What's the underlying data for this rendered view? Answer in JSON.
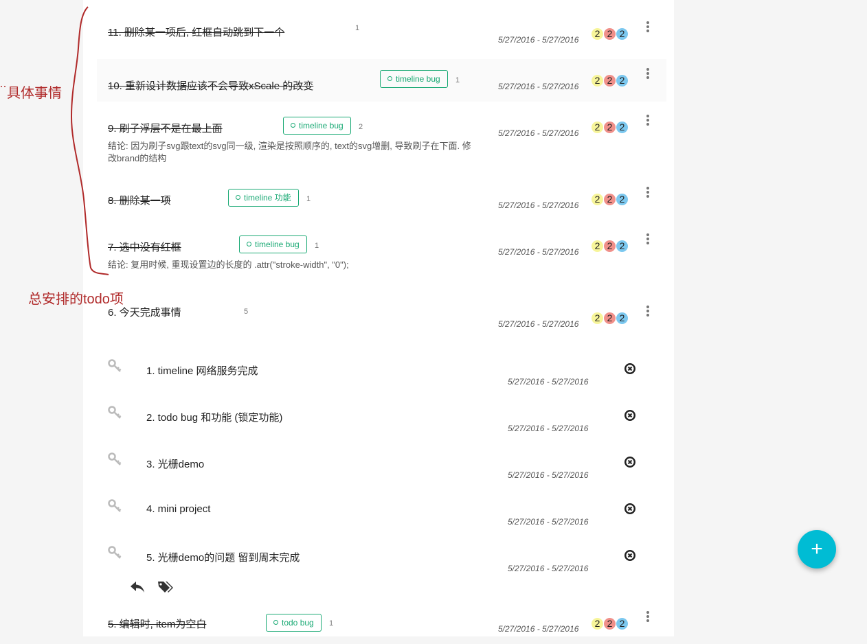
{
  "annotations": {
    "specific": "具体事情",
    "overall": "总安排的todo项"
  },
  "items": [
    {
      "title": "11. 删除某一项后, 红框自动跳到下一个",
      "tag": "",
      "count": "1",
      "date": "5/27/2016 - 5/27/2016",
      "badges": [
        "2",
        "2",
        "2"
      ],
      "done": true
    },
    {
      "title": "10. 重新设计数据应该不会导致xScale 的改变",
      "tag": "timeline bug",
      "count": "1",
      "date": "5/27/2016 - 5/27/2016",
      "badges": [
        "2",
        "2",
        "2"
      ],
      "done": true
    },
    {
      "title": "9. 刷子浮层不是在最上面",
      "tag": "timeline bug",
      "count": "2",
      "date": "5/27/2016 - 5/27/2016",
      "badges": [
        "2",
        "2",
        "2"
      ],
      "done": true,
      "note": "结论: 因为刷子svg跟text的svg同一级, 渲染是按照顺序的, text的svg增删, 导致刷子在下面. 修改brand的结构"
    },
    {
      "title": "8. 删除某一项",
      "tag": "timeline 功能",
      "count": "1",
      "date": "5/27/2016 - 5/27/2016",
      "badges": [
        "2",
        "2",
        "2"
      ],
      "done": true
    },
    {
      "title": "7. 选中没有红框",
      "tag": "timeline bug",
      "count": "1",
      "date": "5/27/2016 - 5/27/2016",
      "badges": [
        "2",
        "2",
        "2"
      ],
      "done": true,
      "note": "结论: 复用时候, 重现设置边的长度的 .attr(\"stroke-width\", \"0\");"
    },
    {
      "title": "6. 今天完成事情",
      "tag": "",
      "count": "5",
      "date": "5/27/2016 - 5/27/2016",
      "badges": [
        "2",
        "2",
        "2"
      ],
      "done": false
    },
    {
      "title": "5. 编辑时, item为空白",
      "tag": "todo bug",
      "count": "1",
      "date": "5/27/2016 - 5/27/2016",
      "badges": [
        "2",
        "2",
        "2"
      ],
      "done": true
    }
  ],
  "subitems": [
    {
      "title": "1. timeline 网络服务完成",
      "date": "5/27/2016 - 5/27/2016"
    },
    {
      "title": "2. todo bug 和功能 (锁定功能)",
      "date": "5/27/2016 - 5/27/2016"
    },
    {
      "title": "3. 光栅demo",
      "date": "5/27/2016 - 5/27/2016"
    },
    {
      "title": "4. mini project",
      "date": "5/27/2016 - 5/27/2016"
    },
    {
      "title": "5. 光栅demo的问题 留到周末完成",
      "date": "5/27/2016 - 5/27/2016"
    }
  ],
  "fab": {
    "label": "+"
  },
  "colors": {
    "accent": "#00bcd4",
    "tag": "#19a974",
    "annotation": "#b02a2a"
  }
}
